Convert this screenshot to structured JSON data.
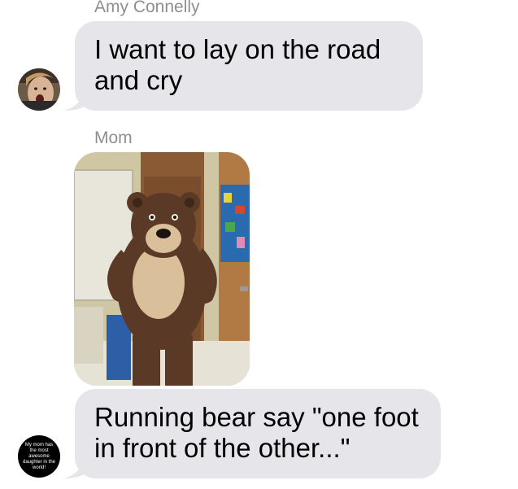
{
  "messages": [
    {
      "sender": "Amy Connelly",
      "text": "I want to lay on the road and cry",
      "avatar_icon": "face-photo-avatar"
    },
    {
      "sender": "Mom",
      "attachment_icon": "bear-mascot-photo"
    },
    {
      "text": "Running bear say \"one foot in front of the other...\"",
      "avatar_icon": "text-badge-avatar",
      "avatar_text": "My mom has the most awesome daughter in the world!"
    }
  ],
  "colors": {
    "bubble": "#e5e5ea",
    "sender_name": "#8e8e93"
  }
}
